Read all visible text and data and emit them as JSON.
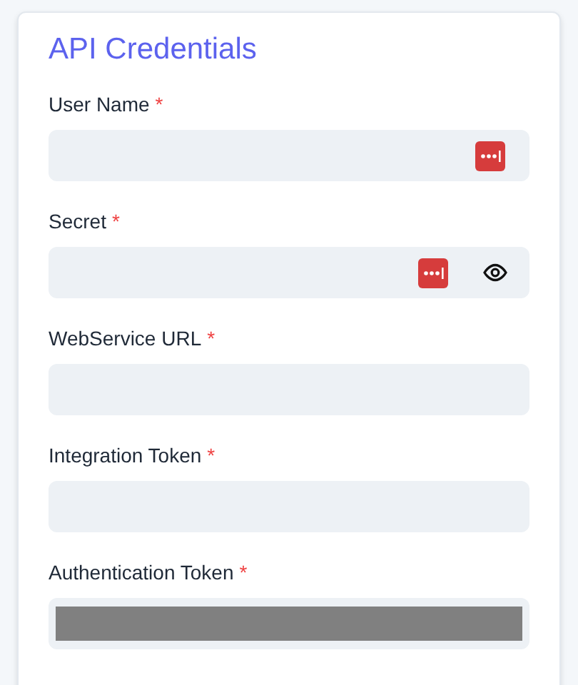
{
  "card": {
    "title": "API Credentials"
  },
  "fields": [
    {
      "label": "User Name",
      "required": "*",
      "password_manager_icon": true,
      "reveal_button": false,
      "redacted": false
    },
    {
      "label": "Secret",
      "required": "*",
      "password_manager_icon": true,
      "reveal_button": true,
      "redacted": false
    },
    {
      "label": "WebService URL",
      "required": "*",
      "password_manager_icon": false,
      "reveal_button": false,
      "redacted": false
    },
    {
      "label": "Integration Token",
      "required": "*",
      "password_manager_icon": false,
      "reveal_button": false,
      "redacted": false
    },
    {
      "label": "Authentication Token",
      "required": "*",
      "password_manager_icon": false,
      "reveal_button": false,
      "redacted": true
    }
  ]
}
